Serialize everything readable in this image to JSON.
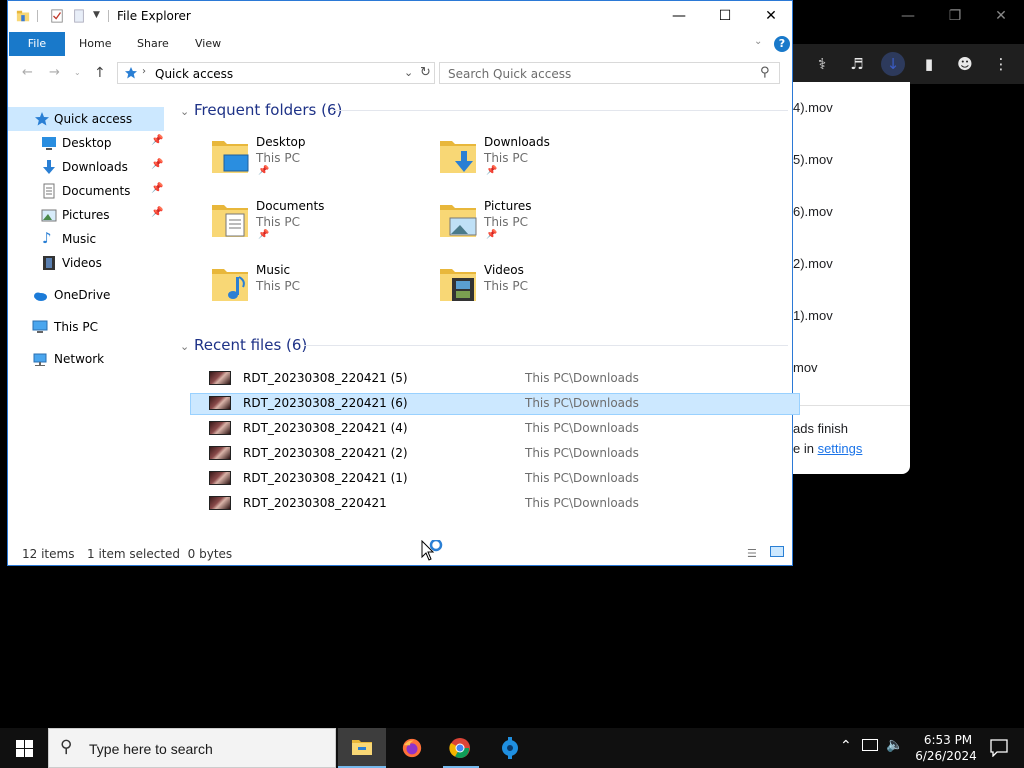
{
  "explorer": {
    "title": "File Explorer",
    "tabs": [
      "File",
      "Home",
      "Share",
      "View"
    ],
    "address": "Quick access",
    "search_placeholder": "Search Quick access",
    "nav": {
      "quick_access": "Quick access",
      "pinned": [
        "Desktop",
        "Downloads",
        "Documents",
        "Pictures"
      ],
      "unpinned": [
        "Music",
        "Videos"
      ],
      "onedrive": "OneDrive",
      "this_pc": "This PC",
      "network": "Network"
    },
    "frequent_header": "Frequent folders (6)",
    "frequent": [
      {
        "name": "Desktop",
        "location": "This PC",
        "pinned": true
      },
      {
        "name": "Downloads",
        "location": "This PC",
        "pinned": true
      },
      {
        "name": "Documents",
        "location": "This PC",
        "pinned": true
      },
      {
        "name": "Pictures",
        "location": "This PC",
        "pinned": true
      },
      {
        "name": "Music",
        "location": "This PC",
        "pinned": false
      },
      {
        "name": "Videos",
        "location": "This PC",
        "pinned": false
      }
    ],
    "recent_header": "Recent files (6)",
    "recent": [
      {
        "name": "RDT_20230308_220421 (5)",
        "location": "This PC\\Downloads",
        "selected": false
      },
      {
        "name": "RDT_20230308_220421 (6)",
        "location": "This PC\\Downloads",
        "selected": true
      },
      {
        "name": "RDT_20230308_220421 (4)",
        "location": "This PC\\Downloads",
        "selected": false
      },
      {
        "name": "RDT_20230308_220421 (2)",
        "location": "This PC\\Downloads",
        "selected": false
      },
      {
        "name": "RDT_20230308_220421 (1)",
        "location": "This PC\\Downloads",
        "selected": false
      },
      {
        "name": "RDT_20230308_220421",
        "location": "This PC\\Downloads",
        "selected": false
      }
    ],
    "status_items": "12 items",
    "status_selected": "1 item selected  0 bytes"
  },
  "chrome_downloads": {
    "items": [
      "4).mov",
      "5).mov",
      "6).mov",
      "2).mov",
      "1).mov",
      "mov"
    ],
    "footer_line1": "ads finish",
    "footer_line2_prefix": "e in ",
    "footer_link": "settings"
  },
  "taskbar": {
    "search_placeholder": "Type here to search",
    "time": "6:53 PM",
    "date": "6/26/2024"
  },
  "colors": {
    "accent": "#1979ca",
    "selection": "#cce8ff",
    "folder_yellow": "#f8d775"
  }
}
